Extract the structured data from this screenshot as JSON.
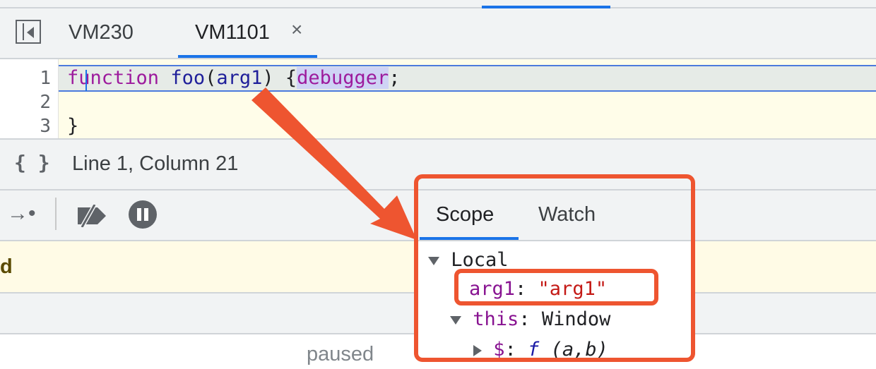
{
  "tabs": [
    {
      "label": "VM230",
      "active": false
    },
    {
      "label": "VM1101",
      "active": true,
      "close": "×"
    }
  ],
  "editor": {
    "line_numbers": [
      "1",
      "2",
      "3"
    ],
    "line1": {
      "keyword": "function",
      "fn_name": "foo",
      "open_paren": "(",
      "param": "arg1",
      "close_paren_brace": ") {",
      "debugger": "debugger",
      "semicolon": ";"
    },
    "line3": "}"
  },
  "status": {
    "braces_icon": "{ }",
    "cursor_position": "Line 1, Column 21"
  },
  "debug_toolbar": {
    "step_icon": "→•",
    "icons": [
      "step-icon",
      "deactivate-breakpoints-icon",
      "pause-on-exceptions-icon"
    ]
  },
  "paused_banner": {
    "text_fragment": "d"
  },
  "footer": {
    "paused_status": "paused"
  },
  "scope": {
    "tabs": [
      "Scope",
      "Watch"
    ],
    "local_label": "Local",
    "arg_name": "arg1",
    "arg_sep": ": ",
    "arg_value": "\"arg1\"",
    "this_name": "this",
    "this_sep": ": ",
    "this_value": "Window",
    "dollar_name": "$",
    "dollar_sep": ": ",
    "dollar_f": "f",
    "dollar_args": " (a,b)"
  },
  "colors": {
    "accent": "#1a73e8",
    "annotation": "#ee5530",
    "keyword": "#9d1b9d",
    "string": "#c41a16"
  }
}
